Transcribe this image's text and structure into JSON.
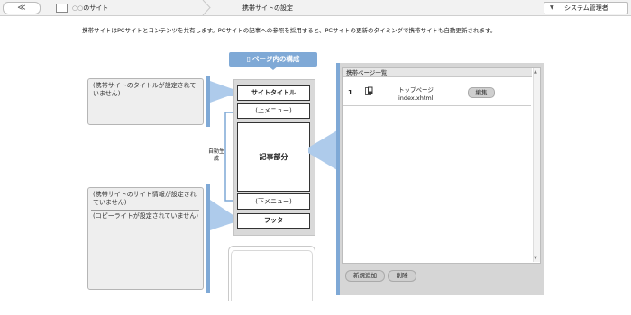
{
  "header": {
    "back_glyph": "≪",
    "breadcrumb_prefix": "○○",
    "breadcrumb_site": "のサイト",
    "breadcrumb_page": "携帯サイトの設定",
    "user_menu_label": "システム管理者",
    "user_menu_glyph": "▼"
  },
  "description": "携帯サイトはPCサイトとコンテンツを共有します。PCサイトの記事への参照を採用すると、PCサイトの更新のタイミングで携帯サイトも自動更新されます。",
  "notes": {
    "title_note": "(携帯サイトのタイトルが設定されていません)",
    "info_note": "(携帯サイトのサイト情報が設定されていません)",
    "copyright_note": "(コピーライトが設定されていません)"
  },
  "structure": {
    "heading": "ページ内の構成",
    "heading_icon": "mobile-phone-icon",
    "blocks": {
      "site_title": "サイトタイトル",
      "top_menu": "(上メニュー)",
      "article": "記事部分",
      "bottom_menu": "(下メニュー)",
      "footer": "フッタ"
    },
    "auto_label": "自動生成"
  },
  "page_list": {
    "header": "携帯ページ一覧",
    "rows": [
      {
        "number": "1",
        "name": "トップページ",
        "file": "index.xhtml",
        "edit_label": "編集"
      }
    ],
    "add_label": "新規追加",
    "delete_label": "削除"
  },
  "colors": {
    "accent_blue": "#7fa9d6",
    "light_blue": "#aecbeb"
  }
}
